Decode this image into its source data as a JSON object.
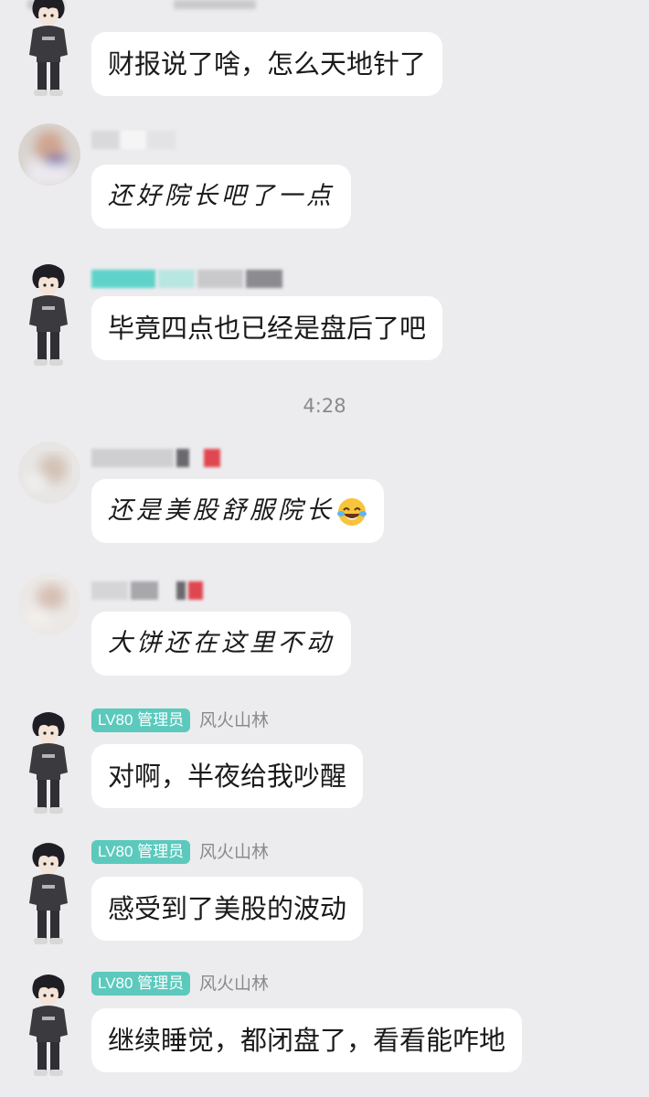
{
  "messages": [
    {
      "text": "财报说了啥，怎么天地针了"
    },
    {
      "text": "还好院长吧了一点"
    },
    {
      "text": "毕竟四点也已经是盘后了吧"
    },
    {
      "text": "还是美股舒服院长"
    },
    {
      "text": "大饼还在这里不动"
    },
    {
      "text": "对啊，半夜给我吵醒",
      "badge": "LV80 管理员",
      "nick": "风火山林"
    },
    {
      "text": "感受到了美股的波动",
      "badge": "LV80 管理员",
      "nick": "风火山林"
    },
    {
      "text": "继续睡觉，都闭盘了，看看能咋地",
      "badge": "LV80 管理员",
      "nick": "风火山林"
    }
  ],
  "timestamp": "4:28",
  "icons": {
    "character_avatar": "character-avatar-icon",
    "photo_avatar": "blurred-photo-avatar",
    "emoji": "tears-of-joy-emoji"
  },
  "colors": {
    "badge": "#5cc9bd",
    "bubble": "#ffffff",
    "background": "#ececee"
  }
}
